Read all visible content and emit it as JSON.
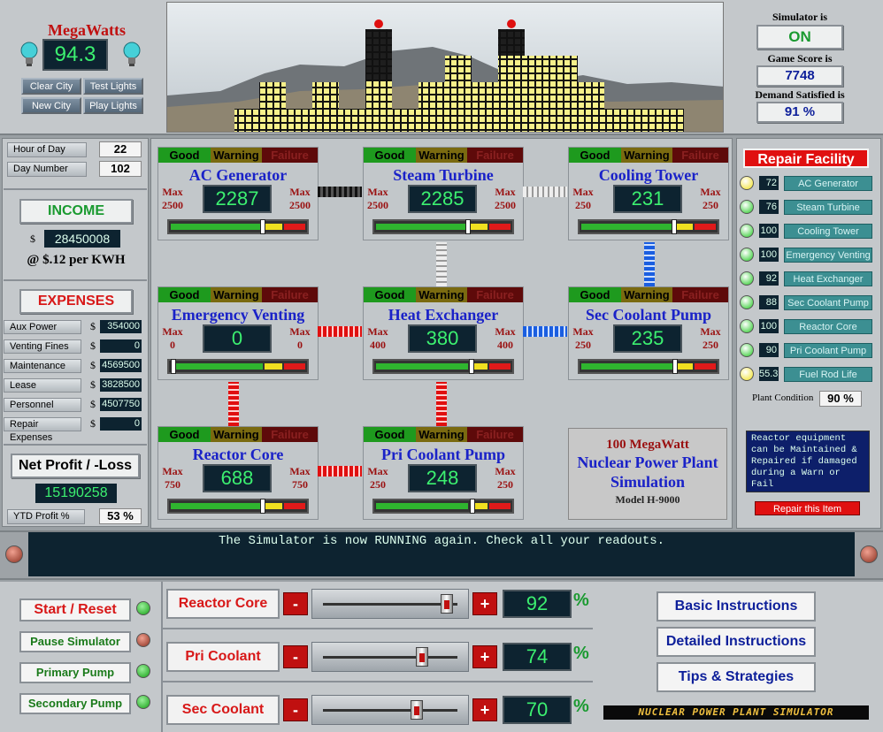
{
  "header": {
    "megawatts_label": "MegaWatts",
    "megawatts_value": "94.3",
    "buttons": [
      "Clear City",
      "Test Lights",
      "New City",
      "Play Lights"
    ],
    "simulator_label": "Simulator is",
    "simulator_status": "ON",
    "score_label": "Game Score is",
    "score_value": "7748",
    "demand_label": "Demand Satisfied is",
    "demand_value": "91 %"
  },
  "left": {
    "hour_label": "Hour of Day",
    "hour_value": "22",
    "day_label": "Day Number",
    "day_value": "102",
    "income_label": "INCOME",
    "income_value": "28450008",
    "rate_text": "@ $.12 per KWH",
    "currency": "$",
    "expenses_label": "EXPENSES",
    "expenses": [
      {
        "label": "Aux Power",
        "value": "354000"
      },
      {
        "label": "Venting Fines",
        "value": "0"
      },
      {
        "label": "Maintenance",
        "value": "4569500"
      },
      {
        "label": "Lease",
        "value": "3828500"
      },
      {
        "label": "Personnel",
        "value": "4507750"
      },
      {
        "label": "Repair Expenses",
        "value": "0"
      }
    ],
    "net_label": "Net Profit / -Loss",
    "net_value": "15190258",
    "ytd_label": "YTD Profit %",
    "ytd_value": "53 %"
  },
  "status_labels": {
    "good": "Good",
    "warning": "Warning",
    "failure": "Failure",
    "max": "Max"
  },
  "components": [
    {
      "name": "AC Generator",
      "max": "2500",
      "value": "2287",
      "level": 0.915
    },
    {
      "name": "Steam Turbine",
      "max": "2500",
      "value": "2285",
      "level": 0.914
    },
    {
      "name": "Cooling Tower",
      "max": "250",
      "value": "231",
      "level": 0.924
    },
    {
      "name": "Emergency Venting",
      "max": "0",
      "value": "0",
      "level": 0.0
    },
    {
      "name": "Heat Exchanger",
      "max": "400",
      "value": "380",
      "level": 0.95
    },
    {
      "name": "Sec Coolant Pump",
      "max": "250",
      "value": "235",
      "level": 0.94
    },
    {
      "name": "Reactor Core",
      "max": "750",
      "value": "688",
      "level": 0.917
    },
    {
      "name": "Pri Coolant Pump",
      "max": "250",
      "value": "248",
      "level": 0.96
    }
  ],
  "info_box": {
    "line1": "100 MegaWatt",
    "line2": "Nuclear Power Plant",
    "line3": "Simulation",
    "model": "Model H-9000"
  },
  "repair": {
    "title": "Repair Facility",
    "items": [
      {
        "label": "AC Generator",
        "value": "72",
        "led": "#f0e020"
      },
      {
        "label": "Steam Turbine",
        "value": "76",
        "led": "#22c822"
      },
      {
        "label": "Cooling Tower",
        "value": "100",
        "led": "#22c822"
      },
      {
        "label": "Emergency Venting",
        "value": "100",
        "led": "#22c822"
      },
      {
        "label": "Heat Exchanger",
        "value": "92",
        "led": "#22c822"
      },
      {
        "label": "Sec Coolant Pump",
        "value": "88",
        "led": "#22c822"
      },
      {
        "label": "Reactor Core",
        "value": "100",
        "led": "#22c822"
      },
      {
        "label": "Pri Coolant Pump",
        "value": "90",
        "led": "#22c822"
      },
      {
        "label": "Fuel Rod Life",
        "value": "55.3",
        "led": "#f0e020"
      }
    ],
    "plant_condition_label": "Plant Condition",
    "plant_condition_value": "90 %",
    "help_text": "Reactor equipment can be Maintained & Repaired if damaged during a Warn or Fail",
    "repair_button": "Repair this Item"
  },
  "message": "The Simulator is now RUNNING again. Check all your readouts.",
  "controls": {
    "start_reset": "Start / Reset",
    "pause": "Pause Simulator",
    "primary_pump": "Primary Pump",
    "secondary_pump": "Secondary Pump",
    "minus": "-",
    "plus": "+",
    "percent": "%",
    "sliders": [
      {
        "label": "Reactor Core",
        "value": "92",
        "level": 0.92
      },
      {
        "label": "Pri Coolant",
        "value": "74",
        "level": 0.74
      },
      {
        "label": "Sec Coolant",
        "value": "70",
        "level": 0.7
      }
    ],
    "instructions": [
      "Basic Instructions",
      "Detailed Instructions",
      "Tips & Strategies"
    ],
    "logo_text": "NUCLEAR POWER PLANT SIMULATOR"
  }
}
